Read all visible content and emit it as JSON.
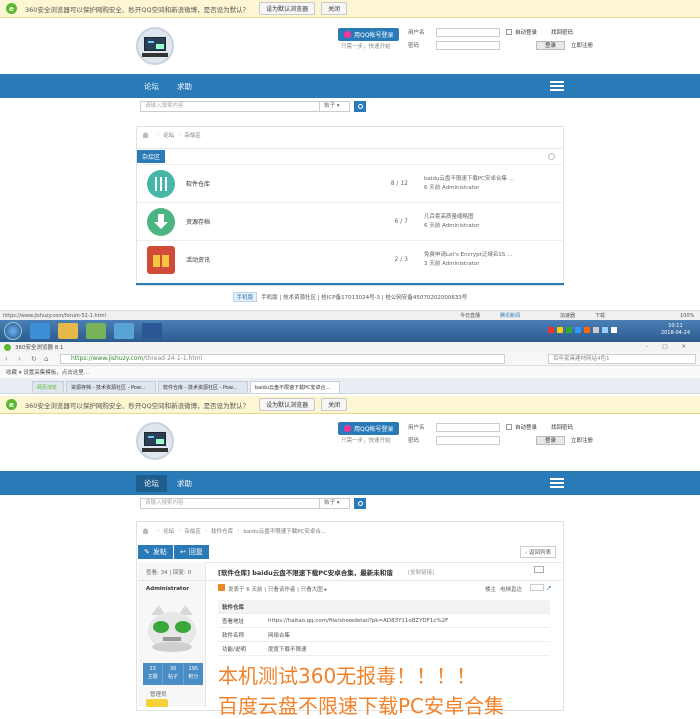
{
  "banner": {
    "text": "360安全浏览器可以保护网购安全、秒开QQ空间和新浪微博，是否设为默认？",
    "set_default": "设为默认浏览器",
    "close": "关闭"
  },
  "site": {
    "qq_login": "用QQ帐号登录",
    "qq_sub": "只需一步，快速开始",
    "username_label": "用户名",
    "password_label": "密码",
    "auto_login": "自动登录",
    "find_password": "找回密码",
    "login_button": "登录",
    "register": "立即注册",
    "nav": [
      "论坛",
      "求助"
    ],
    "search_placeholder": "请输入搜索内容",
    "search_type": "帖子"
  },
  "forum_page": {
    "breadcrumb": [
      "论坛",
      "杂烩区"
    ],
    "category": "杂烩区",
    "forums": [
      {
        "name": "软件仓库",
        "count": "8 / 12",
        "last_title": "baidu云盘不限速下载PC安卓合集 ...",
        "last_by": "6 天前 Administrator",
        "icon": "software-icon",
        "color": "#45b6a8"
      },
      {
        "name": "资源存档",
        "count": "6 / 7",
        "last_title": "几百套高质量缩略图",
        "last_by": "6 天前 Administrator",
        "icon": "download-icon",
        "color": "#4ab583"
      },
      {
        "name": "活动资讯",
        "count": "2 / 3",
        "last_title": "免费申请Let's Encrypt泛域名SS ...",
        "last_by": "3 天前 Administrator",
        "icon": "gift-icon",
        "color": "#d24b38"
      }
    ],
    "footer": "手机版 | 技术资源社区 | 桂ICP备17013024号-3 | 桂公网安备45070202000633号",
    "footer_badge": "手机版",
    "status_url": "https://www.jishuzy.com/forum-51-1.html",
    "status_right": [
      "今日直播",
      "腾讯新闻",
      "加速器",
      "下载",
      "100%"
    ]
  },
  "taskbar": {
    "time": "10:11",
    "date": "2018-04-24"
  },
  "browser2": {
    "title": "360安全浏览器 8.1",
    "url_scheme": "https://",
    "url_host": "www.jishuzy.com",
    "url_path": "/thread-24-1-1.html",
    "search_hint": "百年家具建材网站4色1",
    "bookmarks": "收藏 ▾   设置采集模板，点击这里...",
    "tabs": [
      {
        "label": "网页浏览"
      },
      {
        "label": "资源存档 - 技术资源社区 - Pow..."
      },
      {
        "label": "软件仓库 - 技术资源社区 - Pow..."
      },
      {
        "label": "baidu云盘不限速下载PC安卓合..."
      }
    ]
  },
  "thread_page": {
    "breadcrumb": [
      "论坛",
      "杂烩区",
      "软件仓库",
      "baidu云盘不限速下载PC安卓合..."
    ],
    "back_label": "‹ 返回列表",
    "post_btn": "发帖",
    "reply_btn": "回复",
    "views": "查看: 34",
    "replies": "回复: 0",
    "title": "[软件仓库] baidu云盘不限速下载PC安卓合集，最新未和谐",
    "copy_link": "[复制链接]",
    "author": "Administrator",
    "post_meta": "发表于 6 天前 | 只看该作者 | 只看大图 ▸",
    "floor_label": "楼主",
    "jump_label": "电梯直达",
    "table_header": "软件仓库",
    "table": [
      {
        "k": "查看地址",
        "v": "https://haitao.qq.com/file/showdetail?pk=AD83Y11o8ZYDF1c%2F"
      },
      {
        "k": "软件名称",
        "v": "网络合集"
      },
      {
        "k": "功能/说明",
        "v": "度度下载不限速"
      }
    ],
    "big_line1": "本机测试360无报毒！！！！",
    "big_line2": "百度云盘不限速下载PC安卓合集",
    "stats": [
      [
        "23",
        "主题"
      ],
      [
        "30",
        "帖子"
      ],
      [
        "195",
        "积分"
      ]
    ],
    "role": "管理员"
  }
}
